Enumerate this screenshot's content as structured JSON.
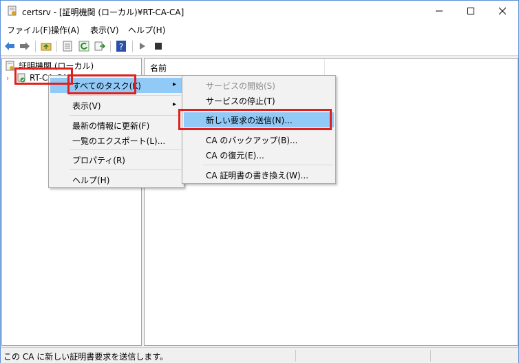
{
  "window": {
    "title": "certsrv - [証明機関 (ローカル)¥RT-CA-CA]"
  },
  "menubar": {
    "items": [
      "ファイル(F)",
      "操作(A)",
      "表示(V)",
      "ヘルプ(H)"
    ]
  },
  "toolbar": {
    "icons": [
      "back-arrow-icon",
      "forward-arrow-icon",
      "up-folder-icon",
      "properties-icon",
      "refresh-icon",
      "export-icon",
      "help-icon",
      "play-icon",
      "stop-icon"
    ]
  },
  "tree": {
    "root_label": "証明機関 (ローカル)",
    "ca_label": "RT-CA-CA"
  },
  "list": {
    "column_name": "名前"
  },
  "context_menu": {
    "items": [
      {
        "label": "すべてのタスク(K)",
        "highlighted": true,
        "submenu": true
      },
      {
        "label": "表示(V)",
        "submenu": true
      },
      {
        "label": "最新の情報に更新(F)"
      },
      {
        "label": "一覧のエクスポート(L)..."
      },
      {
        "label": "プロパティ(R)"
      },
      {
        "label": "ヘルプ(H)"
      }
    ]
  },
  "submenu": {
    "items": [
      {
        "label": "サービスの開始(S)",
        "disabled": true
      },
      {
        "label": "サービスの停止(T)"
      },
      {
        "label": "新しい要求の送信(N)...",
        "highlighted": true
      },
      {
        "label": "CA のバックアップ(B)..."
      },
      {
        "label": "CA の復元(E)..."
      },
      {
        "label": "CA 証明書の書き換え(W)..."
      }
    ]
  },
  "status": {
    "text": "この CA に新しい証明書要求を送信します。"
  },
  "colors": {
    "highlight": "#91c9f7",
    "callout_red": "#e0201b",
    "window_border": "#5a8fd6"
  }
}
